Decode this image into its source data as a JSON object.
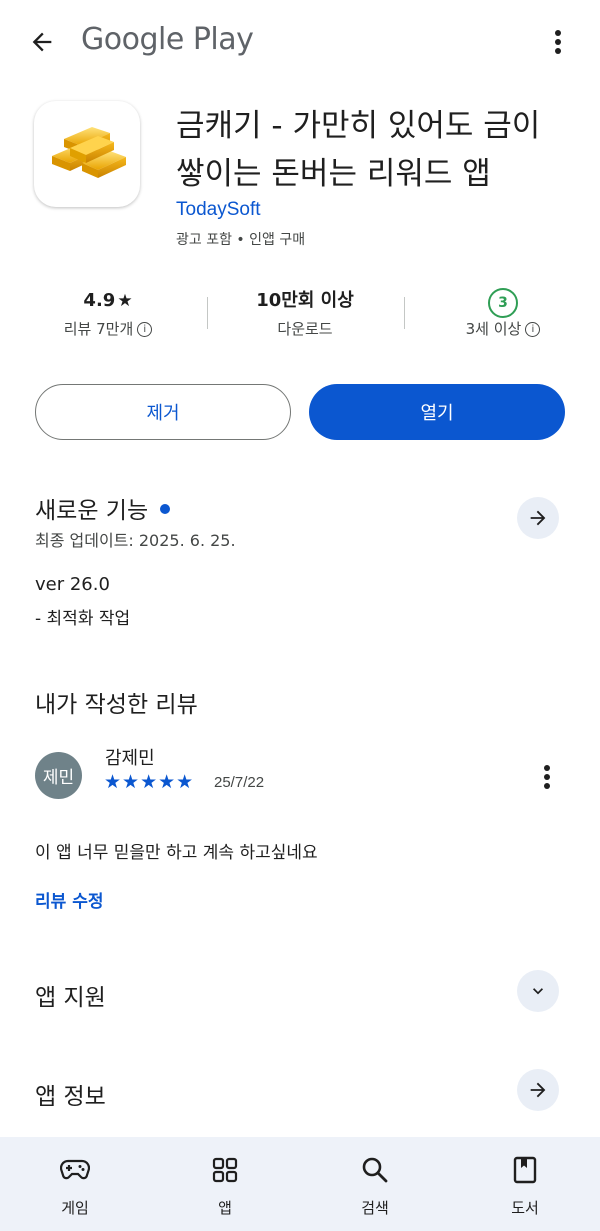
{
  "top_bar": {
    "brand": "Google Play"
  },
  "app": {
    "title_line1": "금캐기 - 가만히 있어도 금이",
    "title_line2": "쌓이는 돈버는 리워드 앱",
    "developer": "TodaySoft",
    "meta": "광고 포함 • 인앱 구매"
  },
  "stats": {
    "rating_value": "4.9",
    "rating_star": "★",
    "rating_label": "리뷰 7만개",
    "downloads_value": "10만회 이상",
    "downloads_label": "다운로드",
    "age_value": "3",
    "age_label": "3세 이상",
    "info_glyph": "i"
  },
  "buttons": {
    "uninstall": "제거",
    "open": "열기"
  },
  "whats_new": {
    "title": "새로운 기능",
    "updated": "최종 업데이트: 2025. 6. 25.",
    "version": "ver 26.0",
    "note": "- 최적화 작업"
  },
  "my_review": {
    "title": "내가 작성한 리뷰",
    "avatar_text": "제민",
    "reviewer": "감제민",
    "stars": "★★★★★",
    "rating": 5,
    "date": "25/7/22",
    "text": "이 앱 너무 믿을만 하고 계속 하고싶네요",
    "edit_link": "리뷰 수정"
  },
  "sections": {
    "app_support": "앱 지원",
    "app_info": "앱 정보"
  },
  "bottom_nav": {
    "games": "게임",
    "apps": "앱",
    "search": "검색",
    "books": "도서"
  },
  "colors": {
    "accent": "#0b57d0",
    "age_green": "#2f9e55",
    "avatar_bg": "#6f8289",
    "nav_bg": "#eef2f9"
  },
  "icons": {
    "back": "arrow-left-icon",
    "more": "more-vert-icon",
    "arrow_right": "arrow-right-icon",
    "chevron_down": "chevron-down-icon",
    "games": "gamepad-icon",
    "apps": "apps-grid-icon",
    "search": "search-icon",
    "books": "bookmark-book-icon",
    "app_logo": "gold-bars-icon"
  }
}
